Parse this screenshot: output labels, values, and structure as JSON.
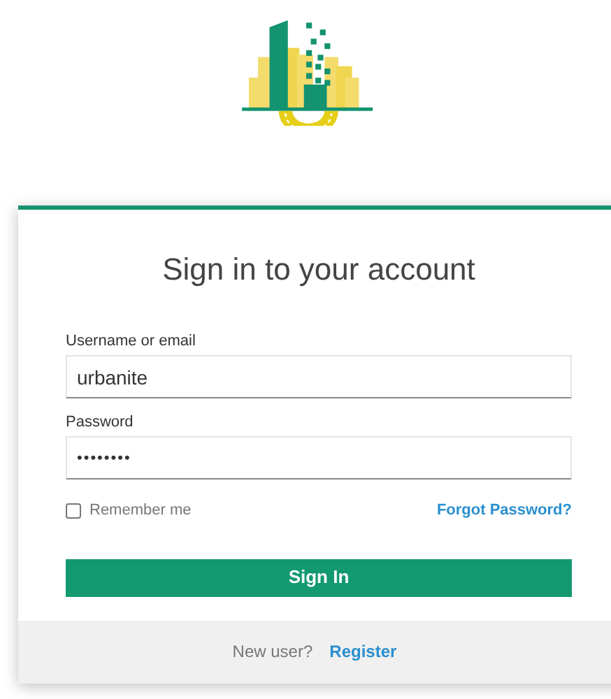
{
  "title": "Sign in to your account",
  "fields": [
    {
      "label": "Username or email",
      "value": "urbanite",
      "kind": "text"
    },
    {
      "label": "Password",
      "value": "••••••••",
      "kind": "password"
    }
  ],
  "remember": {
    "label": "Remember me",
    "checked": false
  },
  "forgot_link": "Forgot Password?",
  "submit": "Sign In",
  "footer": {
    "text": "New user?",
    "link": "Register"
  }
}
